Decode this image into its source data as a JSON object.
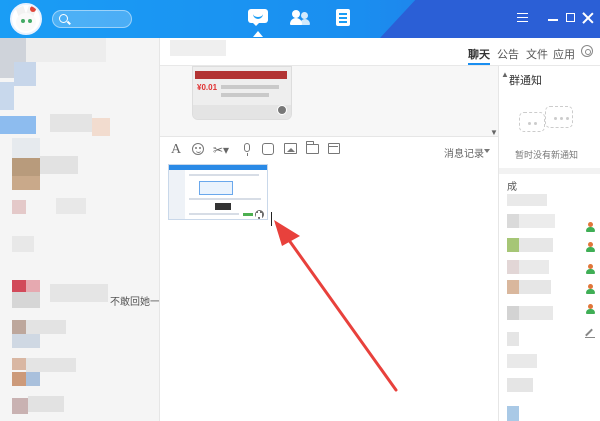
{
  "window": {
    "search_placeholder": "",
    "accent_color": "#1a9df5"
  },
  "nav": {
    "items": [
      {
        "name": "messages",
        "icon": "chat-bubble-icon",
        "active": true
      },
      {
        "name": "contacts",
        "icon": "contacts-icon",
        "active": false
      },
      {
        "name": "apps",
        "icon": "document-icon",
        "active": false
      }
    ]
  },
  "window_controls": {
    "menu_icon": "menu-icon",
    "minimize_icon": "minimize-icon",
    "maximize_icon": "maximize-icon",
    "close_icon": "close-icon"
  },
  "sidebar": {
    "visible_text": "不敢回她一"
  },
  "chat_header": {
    "tabs": [
      {
        "label": "聊天",
        "active": true
      },
      {
        "label": "公告",
        "active": false
      },
      {
        "label": "文件",
        "active": false
      },
      {
        "label": "应用",
        "active": false
      }
    ]
  },
  "message_image": {
    "price_text": "¥0.01"
  },
  "toolbar": {
    "font_label": "A",
    "scissors_label": "✂▾",
    "history_label": "消息记录"
  },
  "right_panel": {
    "title": "群通知",
    "empty_text": "暂时没有新通知",
    "members_label": "成"
  }
}
